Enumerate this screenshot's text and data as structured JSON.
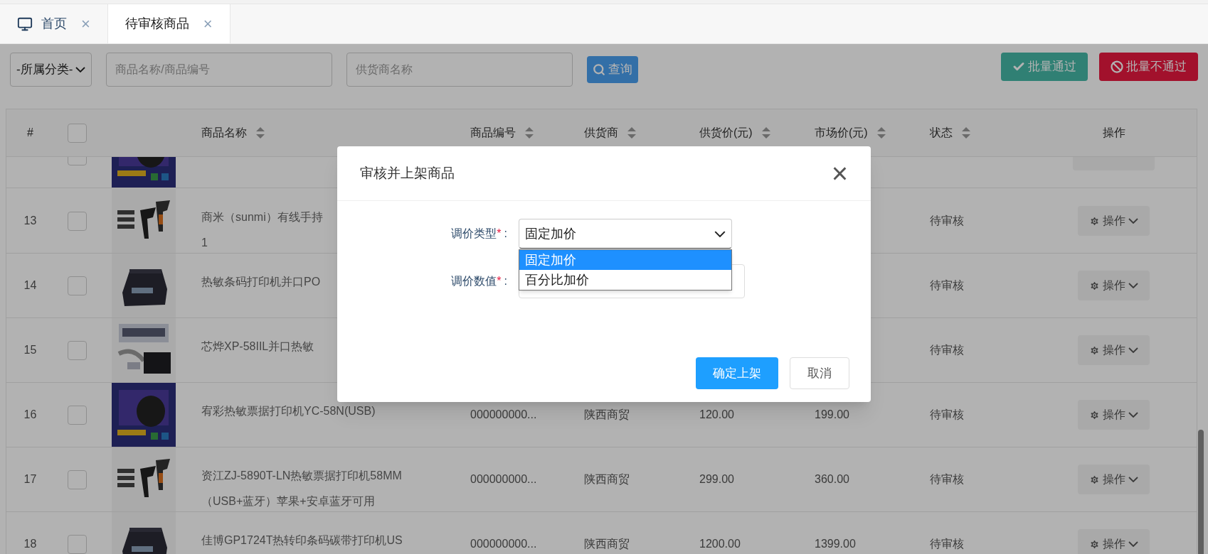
{
  "tabs": [
    {
      "label": "首页",
      "kind": "home",
      "selected": false,
      "close": "×"
    },
    {
      "label": "待审核商品",
      "kind": "page",
      "selected": true,
      "close": "×"
    }
  ],
  "filters": {
    "category_select": {
      "value": "-所属分类-"
    },
    "name_field": {
      "placeholder": "商品名称/商品编号"
    },
    "supplier_field": {
      "placeholder": "供货商名称"
    },
    "query_button": {
      "label": "查询"
    }
  },
  "batch_buttons": [
    {
      "label": "批量通过",
      "kind": "approve"
    },
    {
      "label": "批量不通过",
      "kind": "reject"
    }
  ],
  "table": {
    "header_checkbox": {
      "checked": false
    },
    "columns": [
      {
        "label": "#",
        "sortable": false
      },
      {
        "label": "商品名称",
        "sortable": true
      },
      {
        "label": "商品编号",
        "sortable": true
      },
      {
        "label": "供货商",
        "sortable": true
      },
      {
        "label": "供货价(元)",
        "sortable": true
      },
      {
        "label": "市场价(元)",
        "sortable": true
      },
      {
        "label": "状态",
        "sortable": true
      },
      {
        "label": "操作",
        "sortable": false
      }
    ],
    "rows": [
      {
        "checked": false,
        "image": {
          "kind": "picture"
        },
        "name_lines": [],
        "partial": true
      },
      {
        "index": "13",
        "checked": false,
        "image": {
          "kind": "picture"
        },
        "name_lines": [
          "商米（sunmi）有线手持",
          "1"
        ],
        "status": "待审核",
        "action": "操作"
      },
      {
        "index": "14",
        "checked": false,
        "image": {
          "kind": "picture"
        },
        "name_lines": [
          "热敏条码打印机并口PO"
        ],
        "status": "待审核",
        "action": "操作"
      },
      {
        "index": "15",
        "checked": false,
        "image": {
          "kind": "picture"
        },
        "name_lines": [
          "芯烨XP-58IIL并口热敏"
        ],
        "status": "待审核",
        "action": "操作"
      },
      {
        "index": "16",
        "checked": false,
        "image": {
          "kind": "picture"
        },
        "name_lines": [
          "宥彩热敏票据打印机YC-58N(USB)"
        ],
        "code": "000000000...",
        "supplier": "陕西商贸",
        "supply_price": "120.00",
        "market_price": "199.00",
        "status": "待审核",
        "action": "操作"
      },
      {
        "index": "17",
        "checked": false,
        "image": {
          "kind": "picture"
        },
        "name_lines": [
          "资江ZJ-5890T-LN热敏票据打印机58MM",
          "（USB+蓝牙）苹果+安卓蓝牙可用"
        ],
        "code": "000000000...",
        "supplier": "陕西商贸",
        "supply_price": "299.00",
        "market_price": "360.00",
        "status": "待审核",
        "action": "操作"
      },
      {
        "index": "18",
        "checked": false,
        "image": {
          "kind": "picture"
        },
        "name_lines": [
          "佳博GP1724T热转印条码碳带打印机US"
        ],
        "code": "000000000...",
        "supplier": "陕西商贸",
        "supply_price": "1200.00",
        "market_price": "1399.00",
        "status": "待审核",
        "action": "操作"
      }
    ]
  },
  "modal": {
    "title": "审核并上架商品",
    "close": "×",
    "fields": [
      {
        "kind": "select",
        "label": "调价类型",
        "required_mark": "*",
        "suffix": ":",
        "value": "固定加价",
        "expanded": true,
        "options": [
          {
            "label": "固定加价",
            "selected": true
          },
          {
            "label": "百分比加价",
            "selected": false
          }
        ]
      },
      {
        "kind": "input",
        "label": "调价数值",
        "required_mark": "*",
        "suffix": ":"
      }
    ],
    "buttons": [
      {
        "label": "确定上架",
        "kind": "primary"
      },
      {
        "label": "取消",
        "kind": "default"
      }
    ]
  }
}
